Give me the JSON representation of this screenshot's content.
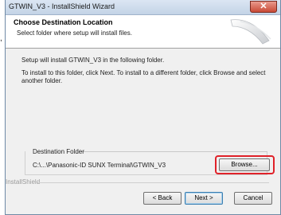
{
  "outside_text": ",",
  "window": {
    "title": "GTWIN_V3 - InstallShield Wizard",
    "close_glyph": "✕"
  },
  "header": {
    "title": "Choose Destination Location",
    "subtitle": "Select folder where setup will install files."
  },
  "body": {
    "line1": "Setup will install GTWIN_V3 in the following folder.",
    "line2": "To install to this folder, click Next. To install to a different folder, click Browse and select another folder."
  },
  "destination": {
    "group_label": "Destination Folder",
    "path": "C:\\...\\Panasonic-ID SUNX Terminal\\GTWIN_V3",
    "browse_label": "Browse..."
  },
  "footer": {
    "brand": "InstallShield",
    "back_label": "< Back",
    "next_label": "Next >",
    "cancel_label": "Cancel"
  },
  "colors": {
    "highlight": "#e0222a",
    "close_button": "#c94a36"
  }
}
